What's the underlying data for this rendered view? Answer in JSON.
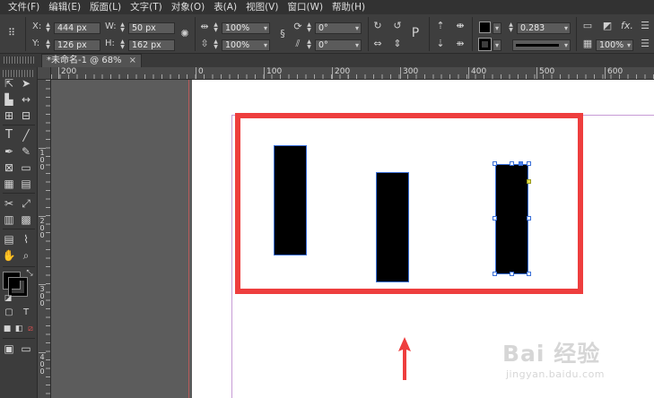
{
  "menu": [
    "文件(F)",
    "编辑(E)",
    "版面(L)",
    "文字(T)",
    "对象(O)",
    "表(A)",
    "视图(V)",
    "窗口(W)",
    "帮助(H)"
  ],
  "control": {
    "x_label": "X:",
    "x_value": "444 px",
    "y_label": "Y:",
    "y_value": "126 px",
    "w_label": "W:",
    "w_value": "50 px",
    "h_label": "H:",
    "h_value": "162 px",
    "scale_x": "100%",
    "scale_y": "100%",
    "rotate": "0°",
    "shear": "0°",
    "stroke_weight": "0.283",
    "opacity": "100%"
  },
  "tab": {
    "title": "*未命名-1 @ 68%",
    "close": "×"
  },
  "ruler_h": [
    "200",
    "0",
    "100",
    "200",
    "300",
    "400",
    "500",
    "600"
  ],
  "ruler_v": [
    [
      "1",
      "0",
      "0"
    ],
    [
      "2",
      "0",
      "0"
    ],
    [
      "3",
      "0",
      "0"
    ],
    [
      "4",
      "0",
      "0"
    ]
  ],
  "colors": {
    "highlight": "#ee3e3e",
    "selection": "#3a6fd8",
    "page": "#ffffff"
  },
  "watermark": {
    "logo": "Bai 经验",
    "sub": "jingyan.baidu.com"
  }
}
